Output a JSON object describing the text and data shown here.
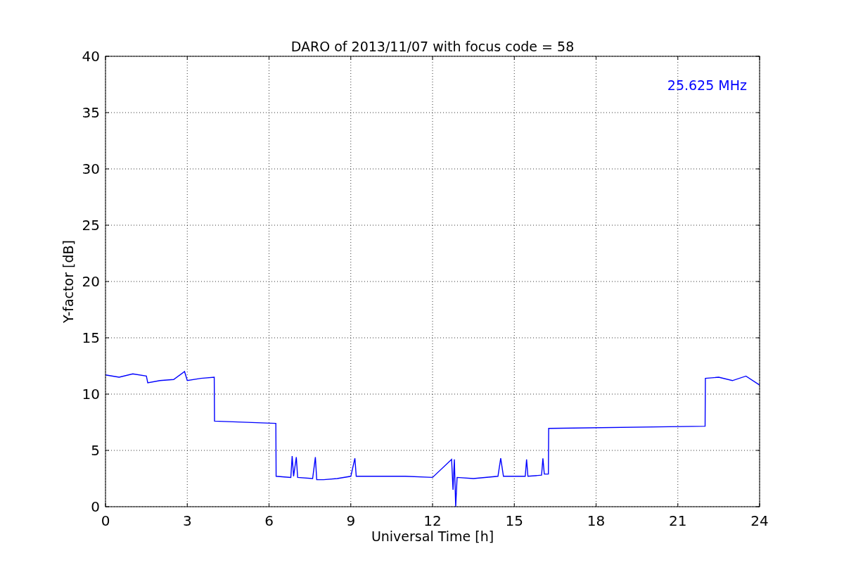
{
  "chart_data": {
    "type": "line",
    "title": "DARO of 2013/11/07 with focus code = 58",
    "xlabel": "Universal Time [h]",
    "ylabel": "Y-factor [dB]",
    "xlim": [
      0,
      24
    ],
    "ylim": [
      0,
      40
    ],
    "xticks": [
      0,
      3,
      6,
      9,
      12,
      15,
      18,
      21,
      24
    ],
    "yticks": [
      0,
      5,
      10,
      15,
      20,
      25,
      30,
      35,
      40
    ],
    "x": [
      0,
      0.5,
      1,
      1.5,
      1.55,
      2,
      2.5,
      2.9,
      3,
      3.5,
      3.99,
      4.0,
      6.25,
      6.26,
      6.8,
      6.85,
      6.9,
      7.0,
      7.05,
      7.6,
      7.7,
      7.75,
      8.0,
      8.5,
      9.0,
      9.15,
      9.2,
      10,
      11,
      12,
      12.7,
      12.75,
      12.8,
      12.85,
      12.9,
      13.5,
      14.4,
      14.5,
      14.6,
      15,
      15.4,
      15.45,
      15.5,
      16,
      16.05,
      16.1,
      16.25,
      16.26,
      22.0,
      22.01,
      22.5,
      23,
      23.5,
      24
    ],
    "series": [
      {
        "color": "#0000ff",
        "values": [
          11.7,
          11.5,
          11.8,
          11.6,
          11.0,
          11.2,
          11.3,
          12.0,
          11.2,
          11.4,
          11.5,
          7.6,
          7.4,
          2.7,
          2.6,
          4.5,
          2.7,
          4.4,
          2.6,
          2.5,
          4.4,
          2.4,
          2.4,
          2.5,
          2.7,
          4.3,
          2.7,
          2.7,
          2.7,
          2.6,
          4.2,
          1.5,
          4.2,
          0.0,
          2.6,
          2.5,
          2.7,
          4.3,
          2.7,
          2.7,
          2.7,
          4.2,
          2.7,
          2.8,
          4.3,
          2.9,
          2.9,
          6.95,
          7.15,
          11.4,
          11.5,
          11.2,
          11.6,
          10.8
        ]
      }
    ],
    "grid": true,
    "annotations": [
      "25.625 MHz"
    ]
  }
}
